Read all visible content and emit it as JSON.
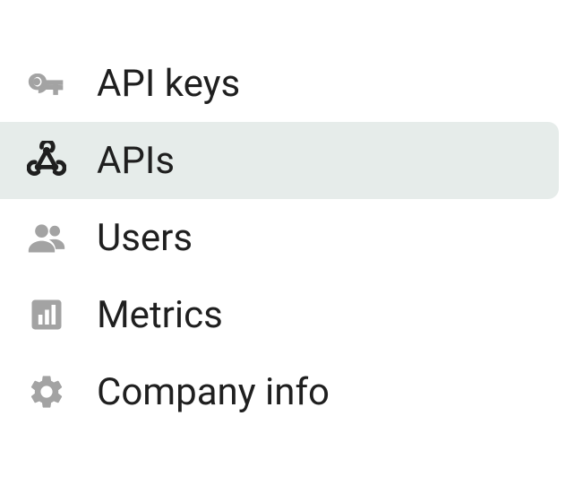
{
  "sidebar": {
    "items": [
      {
        "label": "API keys"
      },
      {
        "label": "APIs"
      },
      {
        "label": "Users"
      },
      {
        "label": "Metrics"
      },
      {
        "label": "Company info"
      }
    ],
    "active_index": 1
  }
}
